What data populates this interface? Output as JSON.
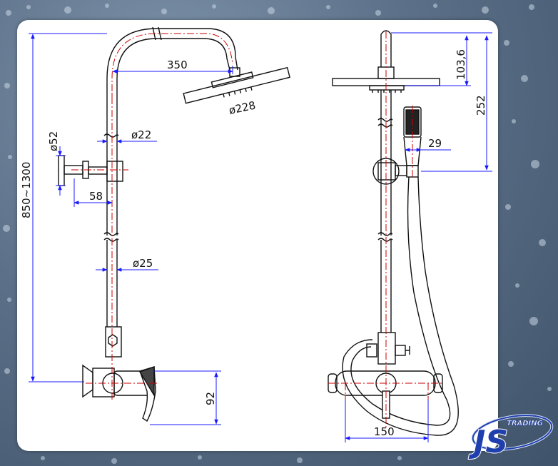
{
  "dimensions": {
    "head_reach": "350",
    "head_diameter": "ø228",
    "upper_pipe_diameter": "ø22",
    "bracket_diameter": "ø52",
    "bracket_offset": "58",
    "lower_pipe_diameter": "ø25",
    "total_height": "850~1300",
    "mixer_height": "92",
    "head_top": "103,6",
    "head_to_holder": "252",
    "hand_shower_offset": "29",
    "mixer_width": "150"
  },
  "logo": {
    "small": "TRADING",
    "large": "JS"
  },
  "colors": {
    "drawing_line": "#111111",
    "centerline": "#cc0000",
    "dimension_line": "#1a1aff",
    "logo_blue": "#1f3fae"
  }
}
